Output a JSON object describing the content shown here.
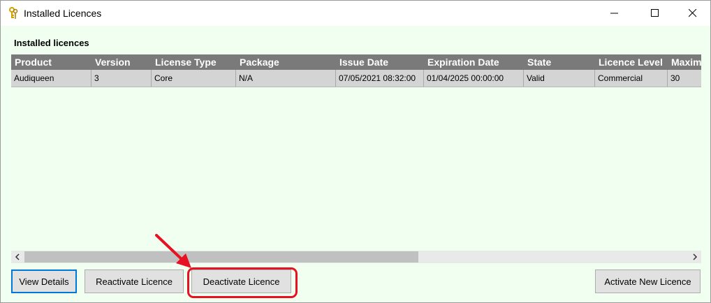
{
  "window": {
    "title": "Installed Licences",
    "controls": [
      "minimize-icon",
      "maximize-icon",
      "close-icon"
    ]
  },
  "section_label": "Installed licences",
  "table": {
    "columns": [
      "Product",
      "Version",
      "License Type",
      "Package",
      "Issue Date",
      "Expiration Date",
      "State",
      "Licence Level",
      "Maxim"
    ],
    "rows": [
      [
        "Audiqueen",
        "3",
        "Core",
        "N/A",
        "07/05/2021 08:32:00",
        "01/04/2025 00:00:00",
        "Valid",
        "Commercial",
        "30"
      ]
    ]
  },
  "buttons": {
    "view_details": "View Details",
    "reactivate": "Reactivate Licence",
    "deactivate": "Deactivate Licence",
    "activate_new": "Activate New Licence"
  },
  "colors": {
    "highlight": "#e81123",
    "window_bg": "#f0fff0",
    "header_bg": "#7a7a7a"
  }
}
